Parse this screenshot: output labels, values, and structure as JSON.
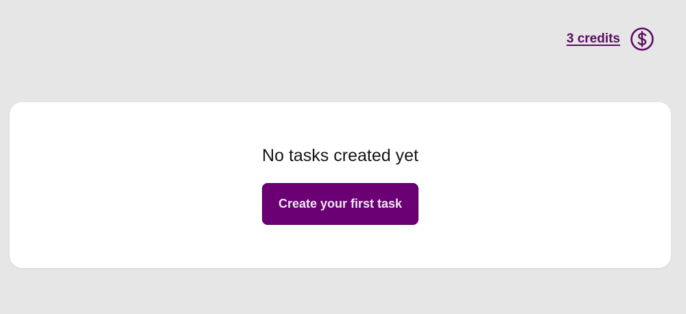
{
  "header": {
    "credits_label": "3 credits",
    "credits_icon": "dollar-circle-icon"
  },
  "empty_state": {
    "message": "No tasks created yet",
    "create_button_label": "Create your first task"
  },
  "colors": {
    "accent": "#6a0073",
    "link": "#5c0a63",
    "page_background": "#e6e6e6",
    "card_background": "#ffffff"
  }
}
